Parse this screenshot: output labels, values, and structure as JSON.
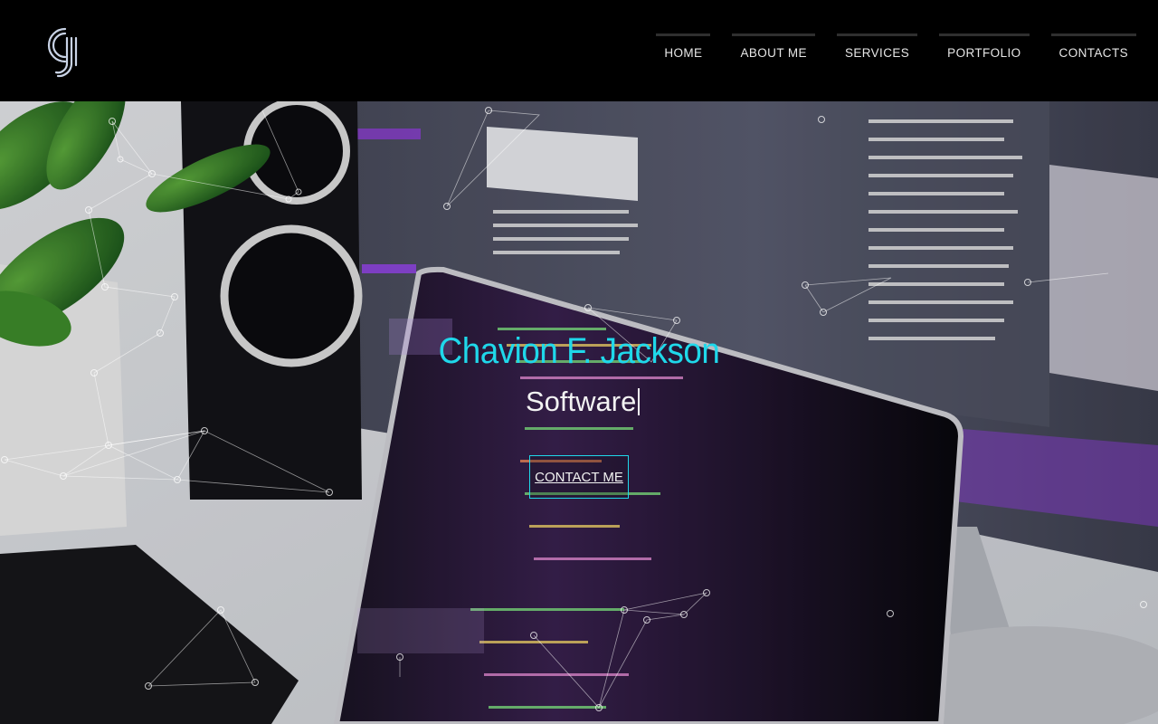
{
  "brand": {
    "logo_icon": "cj-monogram-logo-icon"
  },
  "nav": {
    "items": [
      {
        "label": "HOME"
      },
      {
        "label": "ABOUT ME"
      },
      {
        "label": "SERVICES"
      },
      {
        "label": "PORTFOLIO"
      },
      {
        "label": "CONTACTS"
      }
    ]
  },
  "hero": {
    "name": "Chavion F. Jackson",
    "role": "Software",
    "cta_label": "CONTACT ME"
  },
  "colors": {
    "accent": "#1fd8ea",
    "header_bg": "#000000",
    "nav_text": "#e6e6e6"
  }
}
